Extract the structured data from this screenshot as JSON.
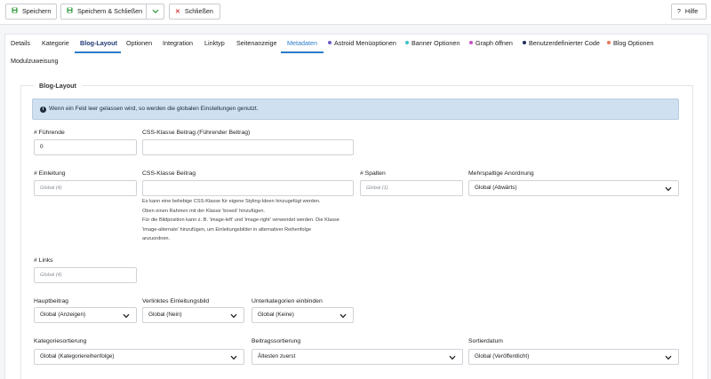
{
  "toolbar": {
    "save": "Speichern",
    "save_close": "Speichern & Schließen",
    "close": "Schließen",
    "help": "Hilfe",
    "help_glyph": "?"
  },
  "tabs": [
    {
      "label": "Details"
    },
    {
      "label": "Kategorie"
    },
    {
      "label": "Blog-Layout"
    },
    {
      "label": "Optionen"
    },
    {
      "label": "Integration"
    },
    {
      "label": "Linktyp"
    },
    {
      "label": "Seitenanzeige"
    },
    {
      "label": "Metadaten"
    },
    {
      "label": "Astroid Menüoptionen"
    },
    {
      "label": "Banner Optionen"
    },
    {
      "label": "Graph öffnen"
    },
    {
      "label": "Benutzerdefinierter Code"
    },
    {
      "label": "Blog Optionen"
    },
    {
      "label": "Modulzuweisung"
    }
  ],
  "colors": {
    "accent": "#2a7cc7",
    "active_tab": "#1f3a73",
    "info_bg": "#cfe0f0",
    "dot_astroid": "#6a5fc8",
    "dot_banner": "#3cc2c8",
    "dot_graph": "#c84fc8",
    "dot_custom": "#1f2e5a",
    "dot_blog": "#e8785a"
  },
  "fieldset": {
    "legend": "Blog-Layout"
  },
  "info": {
    "text": "Wenn ein Feld leer gelassen wird, so werden die globalen Einstellungen genutzt."
  },
  "fields": {
    "fuehrende": {
      "label": "# Führende",
      "value": "0"
    },
    "css_fuehrend": {
      "label": "CSS-Klasse Beitrag (Führender Beitrag)",
      "value": ""
    },
    "einleitung": {
      "label": "# Einleitung",
      "placeholder": "Global (4)"
    },
    "css_beitrag": {
      "label": "CSS-Klasse Beitrag",
      "value": "",
      "help": [
        "Es kann eine beliebige CSS-Klasse für eigene Styling-Ideen hinzugefügt werden.",
        "Oben einen Rahmen mit der Klasse 'boxed' hinzufügen.",
        "Für die Bildposition kann z. B. 'image-left' und 'image-right' verwendet werden. Die Klasse",
        "'image-alternate' hinzufügen, um Einleitungsbilder in alternativer Reihenfolge",
        "anzuordnen."
      ]
    },
    "spalten": {
      "label": "# Spalten",
      "placeholder": "Global (1)"
    },
    "mehrspaltig": {
      "label": "Mehrspaltige Anordnung",
      "value": "Global (Abwärts)"
    },
    "links": {
      "label": "# Links",
      "placeholder": "Global (4)"
    },
    "hauptbeitrag": {
      "label": "Hauptbeitrag",
      "value": "Global (Anzeigen)"
    },
    "einleitungsbild": {
      "label": "Verlinktes Einleitungsbild",
      "value": "Global (Nein)"
    },
    "unterkategorien": {
      "label": "Unterkategorien einbinden",
      "value": "Global (Keine)"
    },
    "kategoriesortierung": {
      "label": "Kategoriesortierung",
      "value": "Global (Kategoriereihenfolge)"
    },
    "beitragssortierung": {
      "label": "Beitragssortierung",
      "value": "Ältesten zuerst"
    },
    "sortierdatum": {
      "label": "Sortierdatum",
      "value": "Global (Veröffentlicht)"
    }
  }
}
